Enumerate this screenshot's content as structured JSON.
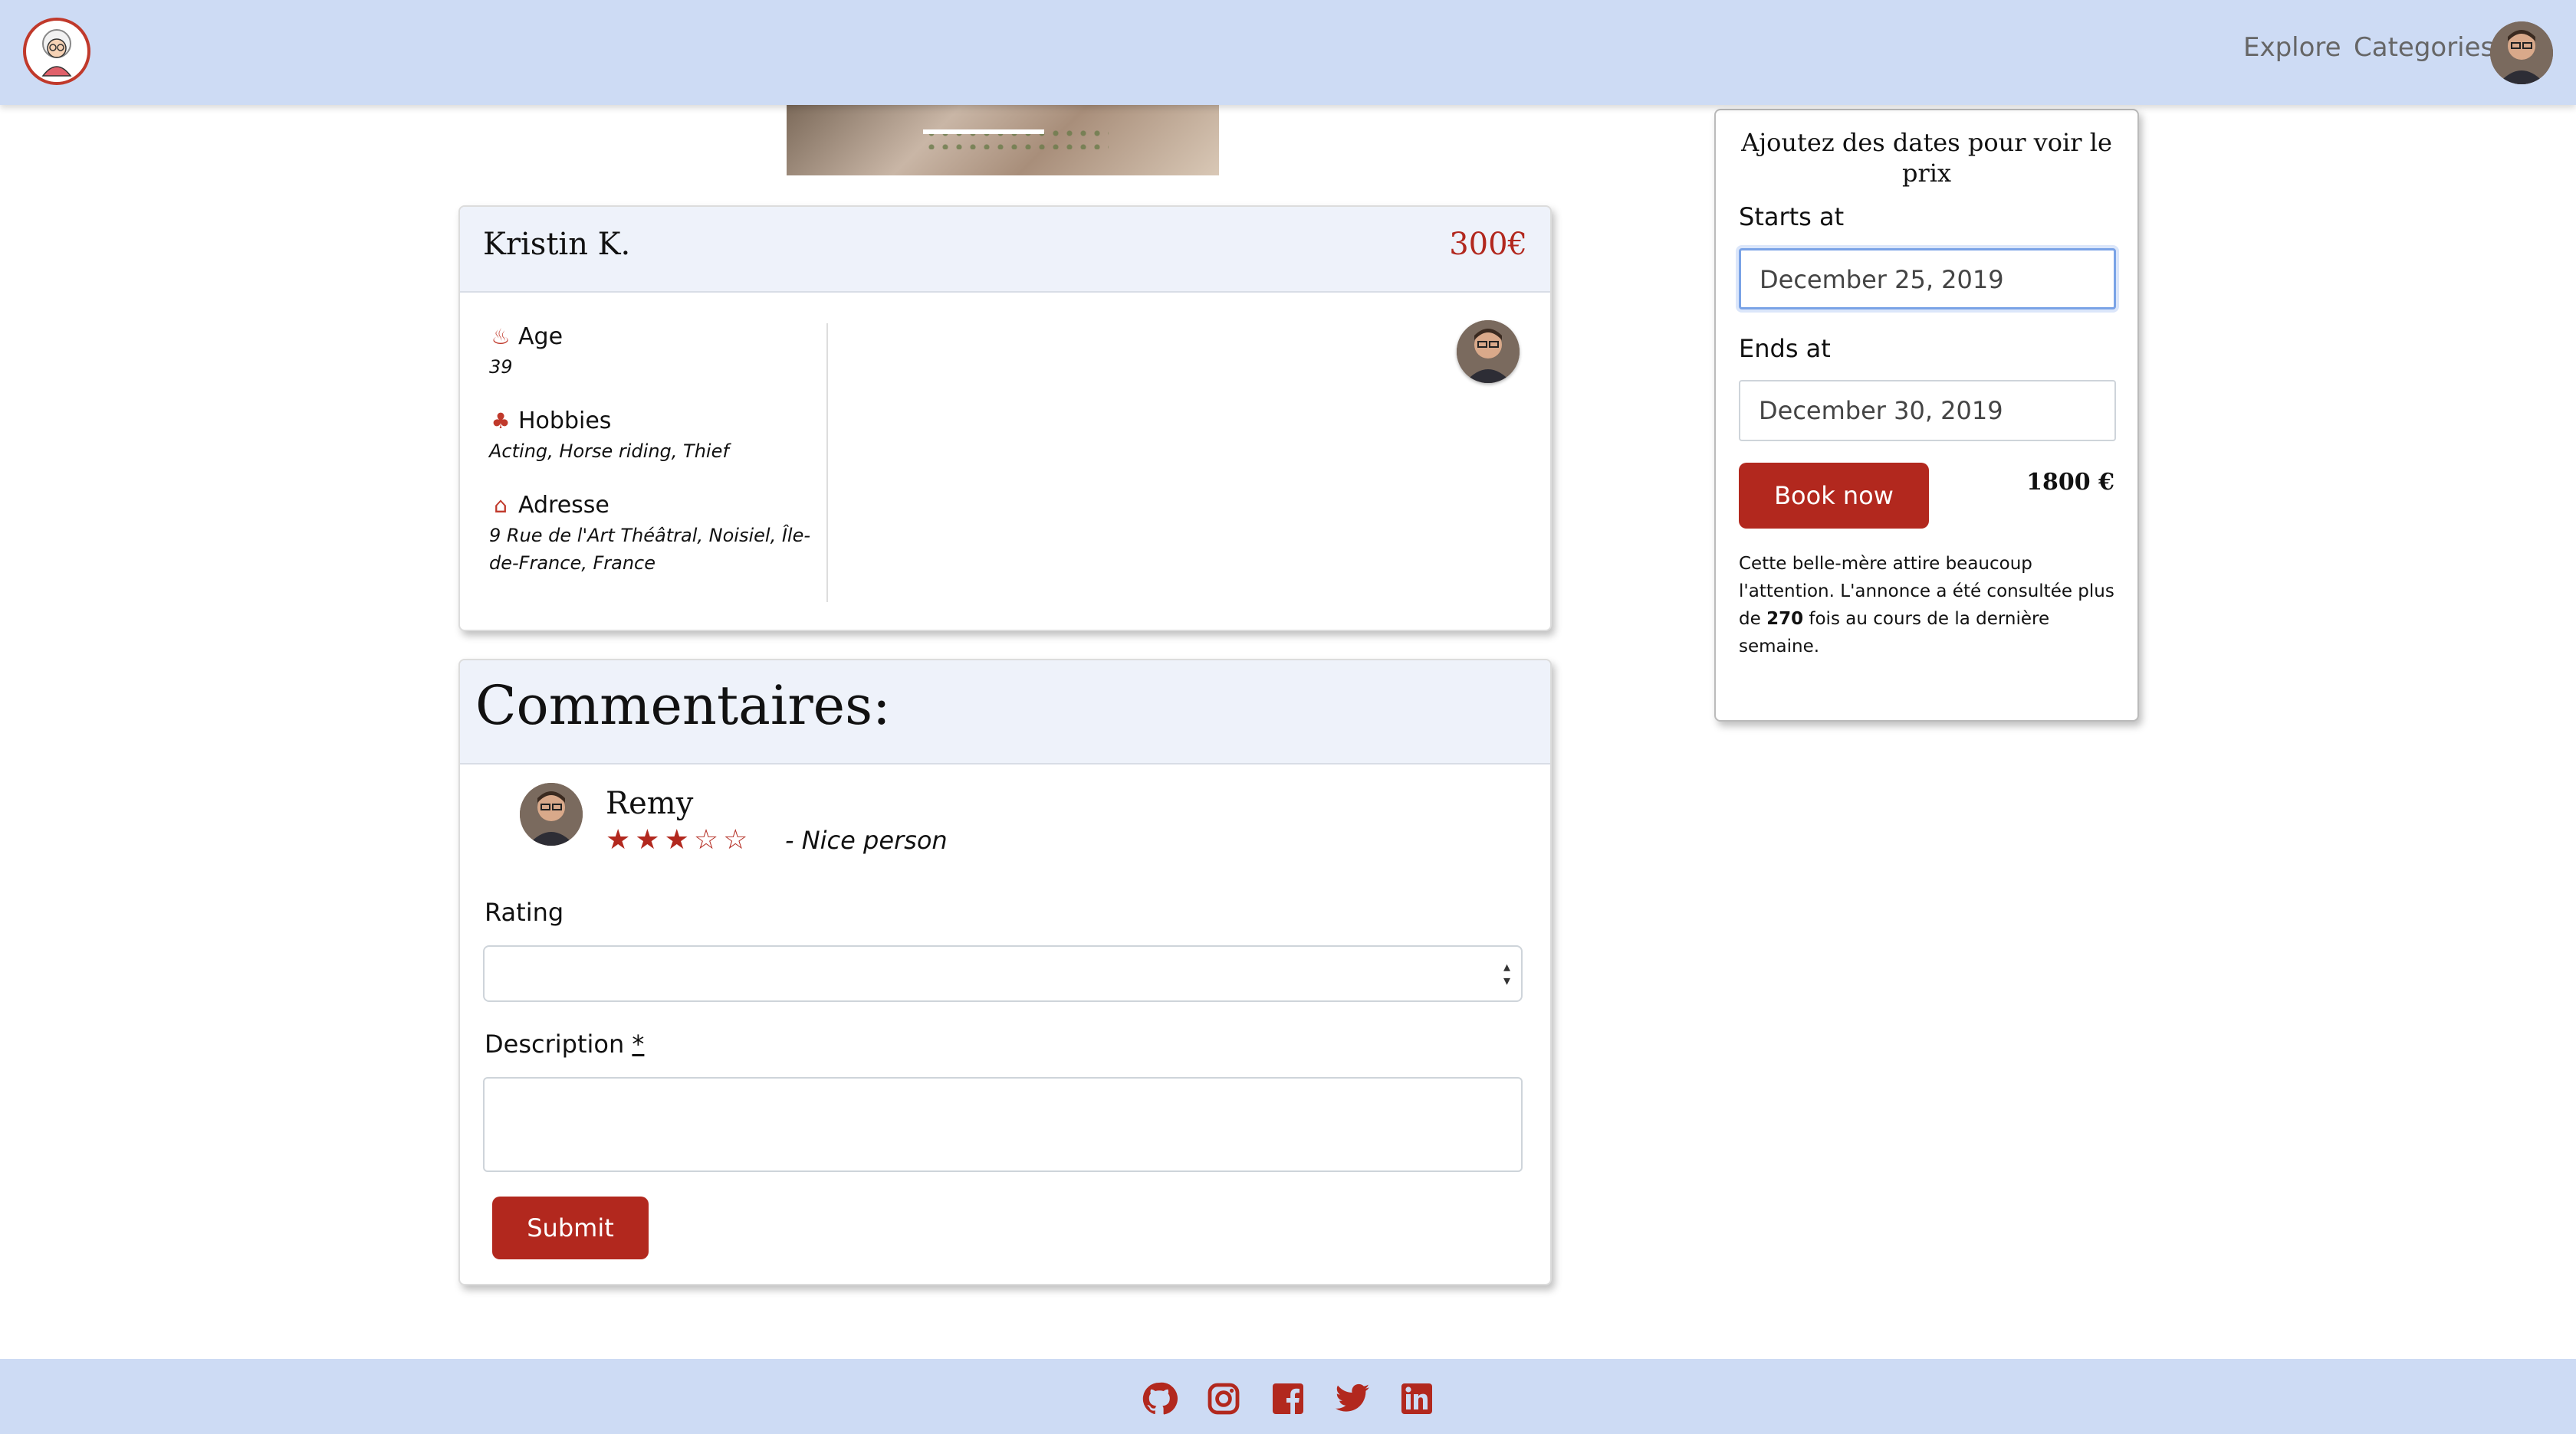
{
  "nav": {
    "explore": "Explore",
    "categories": "Categories"
  },
  "profile": {
    "name": "Kristin K.",
    "price": "300€",
    "age_label": "Age",
    "age_value": "39",
    "hobbies_label": "Hobbies",
    "hobbies_value": "Acting, Horse riding, Thief",
    "address_label": "Adresse",
    "address_value": "9 Rue de l'Art Théâtral, Noisiel, Île-de-France, France"
  },
  "comments": {
    "title": "Commentaires:",
    "items": [
      {
        "author": "Remy",
        "rating": 3,
        "max_rating": 5,
        "text": "- Nice person"
      }
    ],
    "form": {
      "rating_label": "Rating",
      "rating_value": "",
      "description_label": "Description",
      "required_mark": "*",
      "description_value": "",
      "submit_label": "Submit"
    }
  },
  "booking": {
    "title": "Ajoutez des dates pour voir le prix",
    "starts_label": "Starts at",
    "starts_value": "December 25, 2019",
    "ends_label": "Ends at",
    "ends_value": "December 30, 2019",
    "book_label": "Book now",
    "total": "1800 €",
    "desc_before": "Cette belle-mère attire beaucoup l'attention. L'annonce a été consultée plus de ",
    "desc_count": "270",
    "desc_after": " fois au cours de la dernière semaine."
  },
  "footer": {
    "icons": [
      "github-icon",
      "instagram-icon",
      "facebook-icon",
      "twitter-icon",
      "linkedin-icon"
    ]
  },
  "colors": {
    "accent": "#b2281e",
    "nav_bg": "#cddbf4"
  }
}
